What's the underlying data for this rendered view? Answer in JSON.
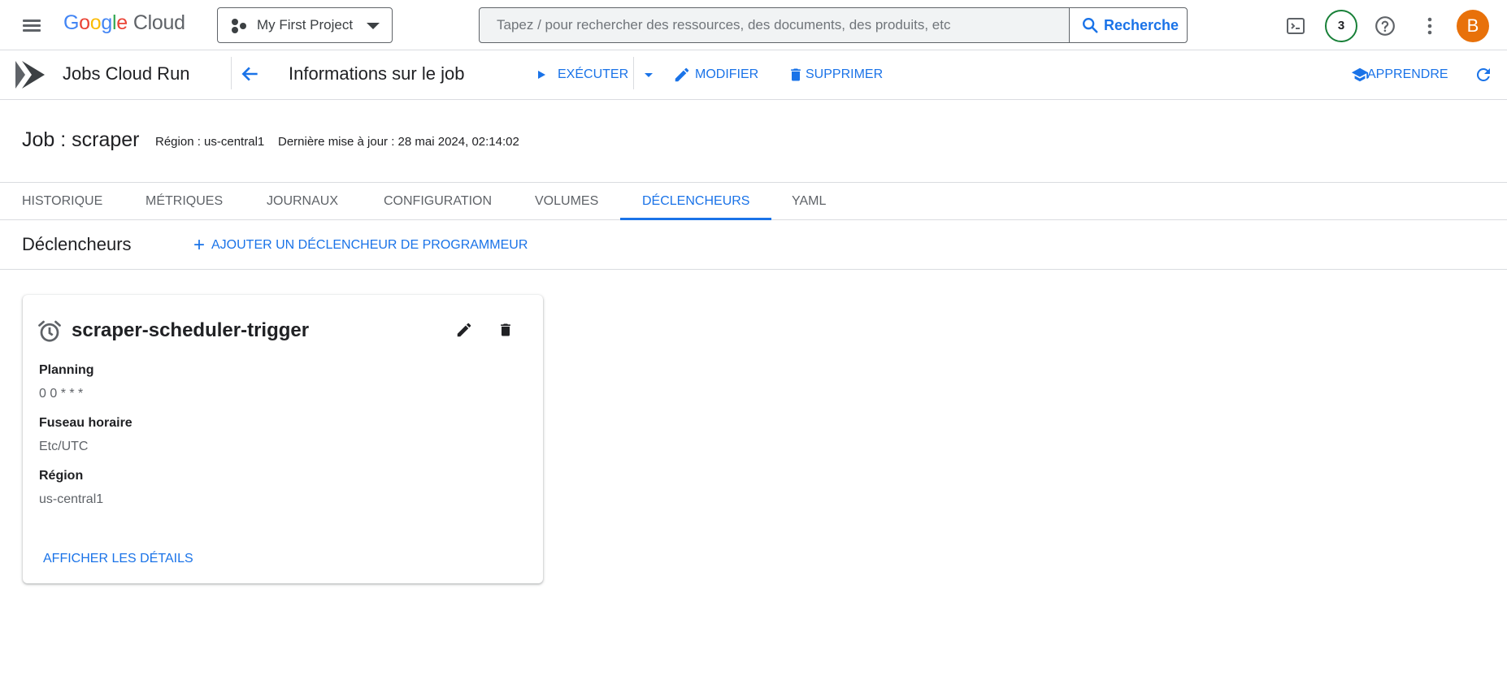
{
  "header": {
    "logo": {
      "google": "Google",
      "cloud": "Cloud"
    },
    "project": "My First Project",
    "search": {
      "placeholder": "Tapez / pour rechercher des ressources, des documents, des produits, etc",
      "button_label": "Recherche"
    },
    "notification_count": "3",
    "avatar_initial": "B"
  },
  "subheader": {
    "service_name": "Jobs Cloud Run",
    "page_title": "Informations sur le job",
    "actions": {
      "run": "EXÉCUTER",
      "edit": "MODIFIER",
      "delete": "SUPPRIMER",
      "learn": "APPRENDRE"
    }
  },
  "job": {
    "title": "Job : scraper",
    "region": "Région : us-central1",
    "last_update": "Dernière mise à jour : 28 mai 2024, 02:14:02"
  },
  "tabs": [
    {
      "label": "HISTORIQUE"
    },
    {
      "label": "MÉTRIQUES"
    },
    {
      "label": "JOURNAUX"
    },
    {
      "label": "CONFIGURATION"
    },
    {
      "label": "VOLUMES"
    },
    {
      "label": "DÉCLENCHEURS"
    },
    {
      "label": "YAML"
    }
  ],
  "active_tab": "DÉCLENCHEURS",
  "triggers": {
    "section_title": "Déclencheurs",
    "add_label": "AJOUTER UN DÉCLENCHEUR DE PROGRAMMEUR",
    "add_icon": "+",
    "card": {
      "name": "scraper-scheduler-trigger",
      "schedule_label": "Planning",
      "schedule_value": "0 0 * * *",
      "timezone_label": "Fuseau horaire",
      "timezone_value": "Etc/UTC",
      "region_label": "Région",
      "region_value": "us-central1",
      "details_label": "AFFICHER LES DÉTAILS"
    }
  },
  "colors": {
    "accent": "#1a73e8",
    "badge_border": "#188038",
    "avatar_bg": "#e8710a"
  }
}
